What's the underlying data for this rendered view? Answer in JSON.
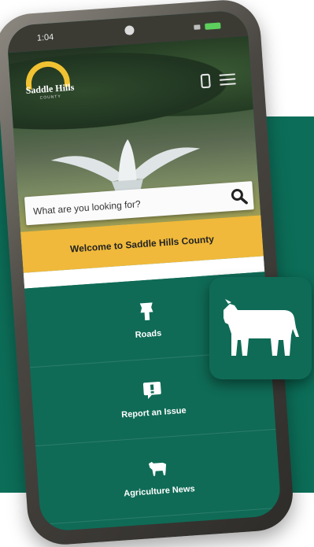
{
  "status_bar": {
    "time": "1:04"
  },
  "header": {
    "logo_name": "Saddle Hills",
    "logo_subtitle": "COUNTY"
  },
  "search": {
    "placeholder": "What are you looking for?"
  },
  "welcome": {
    "text": "Welcome to Saddle Hills County"
  },
  "tiles": [
    {
      "label": "Roads",
      "icon": "road-sign-icon"
    },
    {
      "label": "Report an Issue",
      "icon": "flag-report-icon"
    },
    {
      "label": "Agriculture News",
      "icon": "cow-icon"
    }
  ],
  "floating_card": {
    "icon": "cow-icon"
  },
  "colors": {
    "brand_green": "#0c6e58",
    "accent_yellow": "#f0b93b",
    "phone_frame": "#4a4742"
  }
}
